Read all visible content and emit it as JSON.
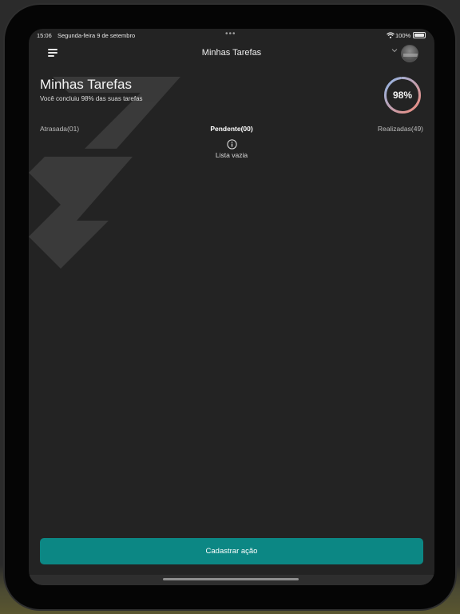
{
  "status_bar": {
    "time": "15:06",
    "date": "Segunda-feira 9 de setembro",
    "dots": "•••",
    "battery": "100%"
  },
  "nav": {
    "title": "Minhas Tarefas",
    "menu_icon": "menu-icon",
    "dropdown_icon": "chevron-down-icon"
  },
  "header": {
    "title": "Minhas Tarefas",
    "subtitle": "Você concluiu 98% das suas tarefas",
    "progress_label": "98%",
    "progress_value": 0.98
  },
  "tabs": [
    {
      "label": "Atrasada(01)",
      "active": false
    },
    {
      "label": "Pendente(00)",
      "active": true
    },
    {
      "label": "Realizadas(49)",
      "active": false
    }
  ],
  "empty_state": {
    "icon": "info-icon",
    "text": "Lista vazia"
  },
  "actions": {
    "primary_label": "Cadastrar ação"
  },
  "colors": {
    "background": "#232323",
    "accent": "#0c8784",
    "ring_start": "#f08a7a",
    "ring_end": "#8fb6e8"
  }
}
